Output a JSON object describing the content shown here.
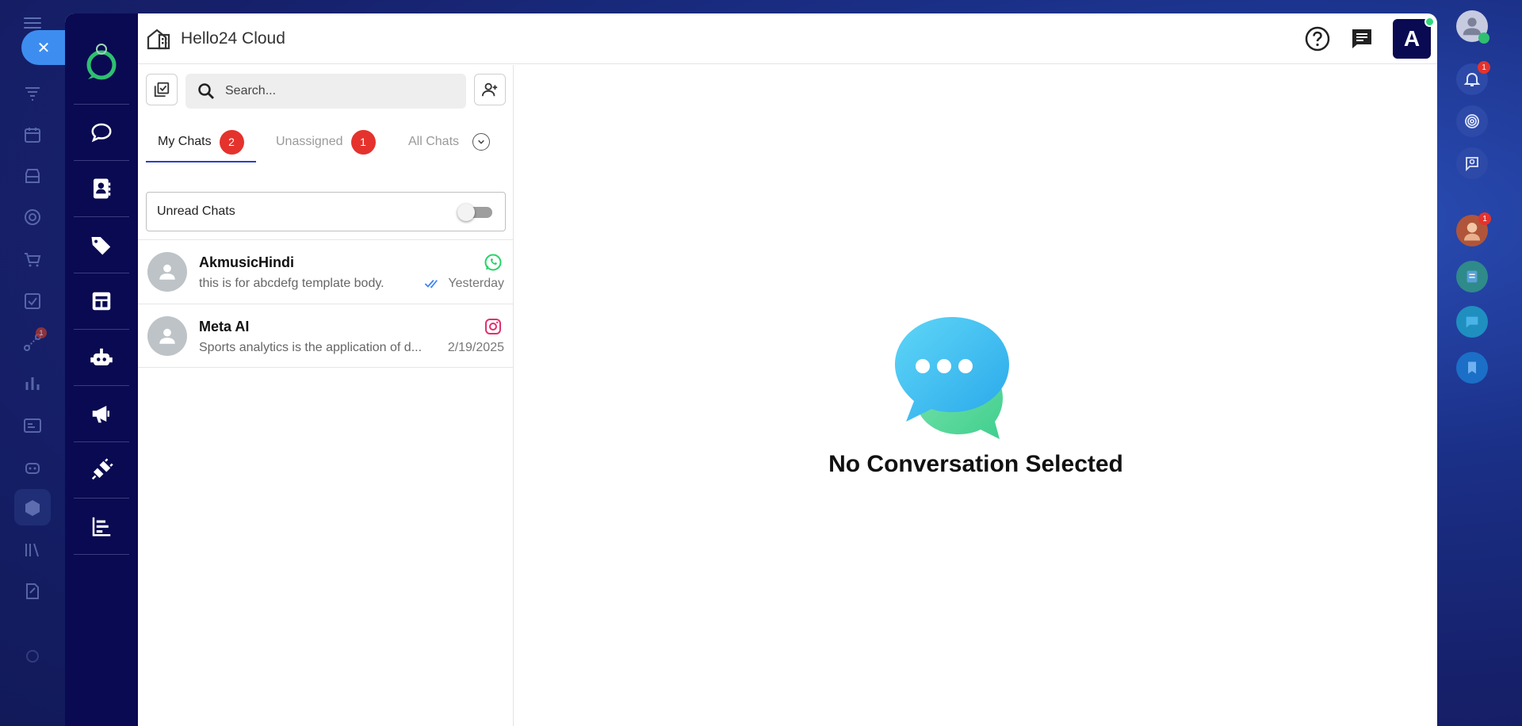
{
  "header": {
    "title": "Hello24 Cloud",
    "avatar_letter": "A"
  },
  "search": {
    "placeholder": "Search..."
  },
  "tabs": [
    {
      "label": "My Chats",
      "badge": "2"
    },
    {
      "label": "Unassigned",
      "badge": "1"
    },
    {
      "label": "All Chats"
    }
  ],
  "filter": {
    "label": "Unread Chats",
    "enabled": false
  },
  "chats": [
    {
      "name": "AkmusicHindi",
      "preview": "this is for abcdefg template body.",
      "time": "Yesterday",
      "channel": "whatsapp-icon",
      "read_receipt": true
    },
    {
      "name": "Meta AI",
      "preview": "Sports analytics is the application of d...",
      "time": "2/19/2025",
      "channel": "instagram-icon",
      "read_receipt": false
    }
  ],
  "empty_state": {
    "title": "No Conversation Selected"
  },
  "right_rail": {
    "notifications_badge": "1",
    "contact_badge": "1"
  },
  "bg_rail": {
    "badge": "1"
  },
  "colors": {
    "nav_bg": "#0a0a52",
    "accent_blue": "#2a3fc9",
    "badge_red": "#e5322d",
    "whatsapp": "#25d366",
    "instagram": "#e1306c"
  }
}
